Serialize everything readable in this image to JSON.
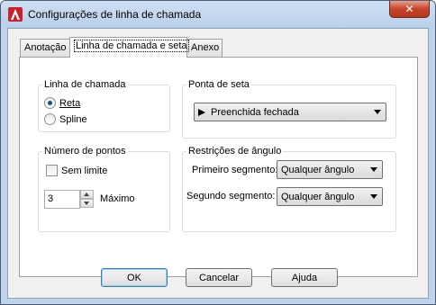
{
  "window": {
    "title": "Configurações de linha de chamada",
    "close_glyph": "✕"
  },
  "tabs": [
    {
      "label": "Anotação"
    },
    {
      "label": "Linha de chamada e seta",
      "active": true
    },
    {
      "label": "Anexo"
    }
  ],
  "leader_line": {
    "title": "Linha de chamada",
    "options": [
      {
        "label": "Reta",
        "checked": true
      },
      {
        "label": "Spline",
        "checked": false
      }
    ]
  },
  "arrowhead": {
    "title": "Ponta de seta",
    "selected": "Preenchida fechada",
    "icon": "closed-filled-arrowhead-icon"
  },
  "number_of_points": {
    "title": "Número de pontos",
    "no_limit_label": "Sem limite",
    "no_limit_checked": false,
    "value": "3",
    "max_label": "Máximo"
  },
  "angle_constrain": {
    "title": "Restrições de ângulo",
    "first_label": "Primeiro segmento:",
    "first_value": "Qualquer ângulo",
    "second_label": "Segundo segmento:",
    "second_value": "Qualquer ângulo"
  },
  "buttons": {
    "ok": "OK",
    "cancel": "Cancelar",
    "help": "Ajuda"
  },
  "colors": {
    "frame": "#bfd3ea",
    "close_button": "#c7442a",
    "radio_dot": "#1c4f8a"
  }
}
